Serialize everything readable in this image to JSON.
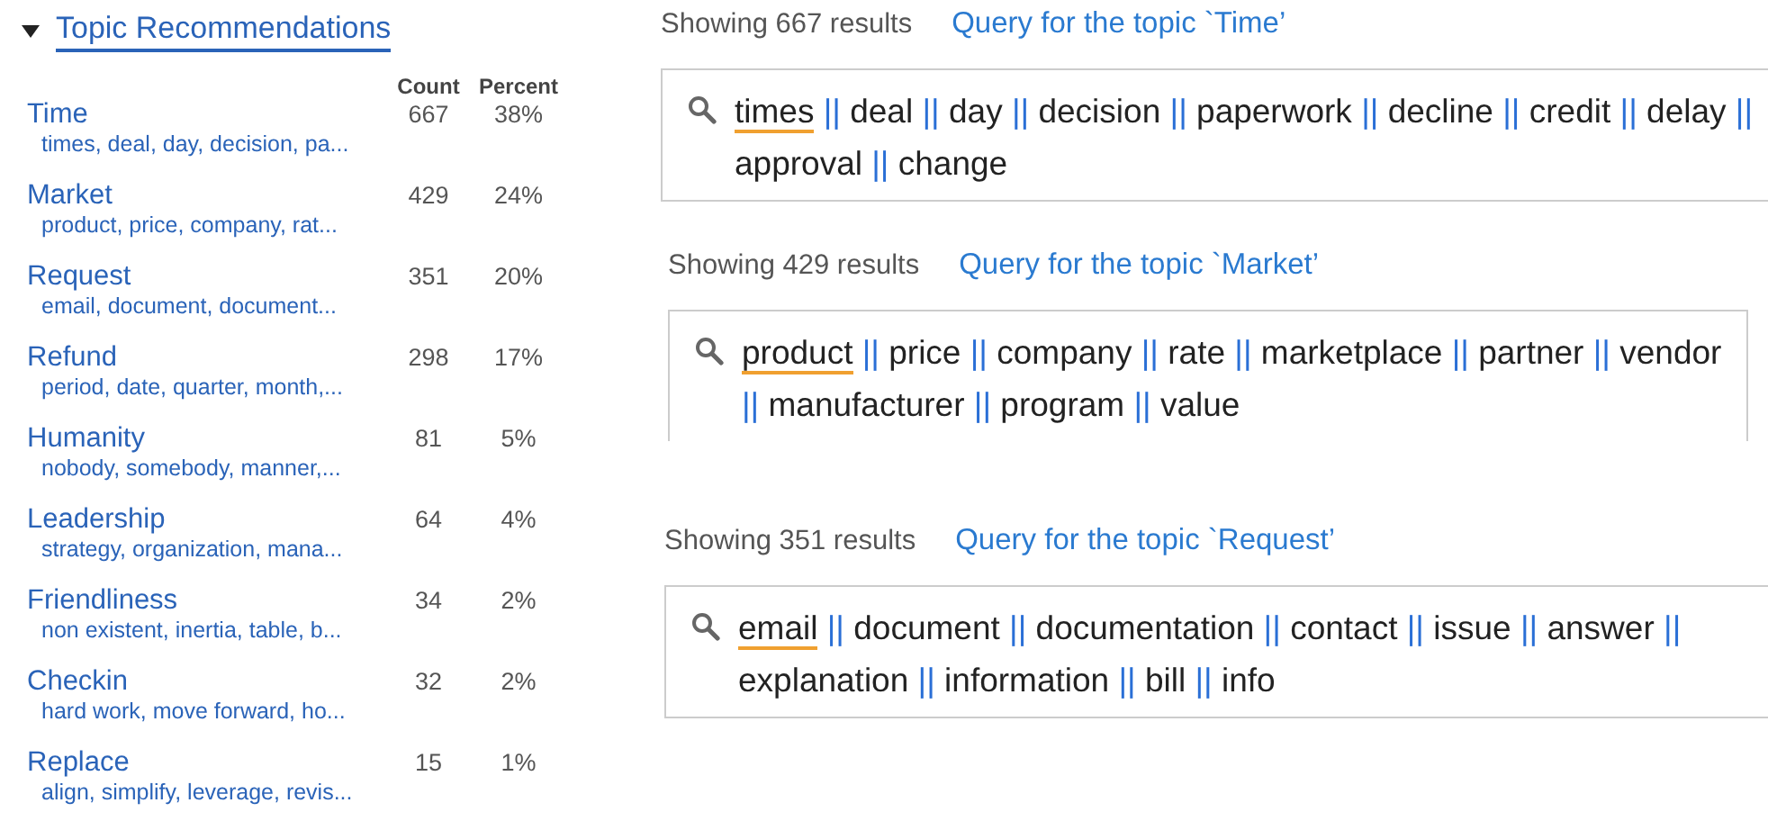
{
  "panel": {
    "title": "Topic Recommendations",
    "expanded": true,
    "columns": [
      "Count",
      "Percent"
    ],
    "topics": [
      {
        "name": "Time",
        "keywords": "times, deal, day, decision, pa...",
        "count": "667",
        "percent": "38%"
      },
      {
        "name": "Market",
        "keywords": "product, price, company, rat...",
        "count": "429",
        "percent": "24%"
      },
      {
        "name": "Request",
        "keywords": "email, document, document...",
        "count": "351",
        "percent": "20%"
      },
      {
        "name": "Refund",
        "keywords": "period, date, quarter, month,...",
        "count": "298",
        "percent": "17%"
      },
      {
        "name": "Humanity",
        "keywords": "nobody, somebody, manner,...",
        "count": "81",
        "percent": "5%"
      },
      {
        "name": "Leadership",
        "keywords": "strategy, organization, mana...",
        "count": "64",
        "percent": "4%"
      },
      {
        "name": "Friendliness",
        "keywords": "non existent, inertia, table, b...",
        "count": "34",
        "percent": "2%"
      },
      {
        "name": "Checkin",
        "keywords": "hard work, move forward, ho...",
        "count": "32",
        "percent": "2%"
      },
      {
        "name": "Replace",
        "keywords": "align, simplify, leverage, revis...",
        "count": "15",
        "percent": "1%"
      }
    ]
  },
  "queries": [
    {
      "results": "Showing 667 results",
      "title": "Query for the topic `Time’",
      "items": [
        {
          "kind": "term",
          "text": "times",
          "underlined": true
        },
        {
          "kind": "separator",
          "text": "||"
        },
        {
          "kind": "term",
          "text": "deal",
          "underlined": false
        },
        {
          "kind": "separator",
          "text": "||"
        },
        {
          "kind": "term",
          "text": "day",
          "underlined": false
        },
        {
          "kind": "separator",
          "text": "||"
        },
        {
          "kind": "term",
          "text": "decision",
          "underlined": false
        },
        {
          "kind": "separator",
          "text": "||"
        },
        {
          "kind": "term",
          "text": "paperwork",
          "underlined": false
        },
        {
          "kind": "separator",
          "text": "||"
        },
        {
          "kind": "term",
          "text": "decline",
          "underlined": false
        },
        {
          "kind": "separator",
          "text": "||"
        },
        {
          "kind": "term",
          "text": "credit",
          "underlined": false
        },
        {
          "kind": "separator",
          "text": "||"
        },
        {
          "kind": "term",
          "text": "delay",
          "underlined": false
        },
        {
          "kind": "separator",
          "text": "||"
        },
        {
          "kind": "term",
          "text": "approval",
          "underlined": false
        },
        {
          "kind": "separator",
          "text": "||"
        },
        {
          "kind": "term",
          "text": "change",
          "underlined": false
        }
      ]
    },
    {
      "results": "Showing 429 results",
      "title": "Query for the topic `Market’",
      "items": [
        {
          "kind": "term",
          "text": "product",
          "underlined": true
        },
        {
          "kind": "separator",
          "text": "||"
        },
        {
          "kind": "term",
          "text": "price",
          "underlined": false
        },
        {
          "kind": "separator",
          "text": "||"
        },
        {
          "kind": "term",
          "text": "company",
          "underlined": false
        },
        {
          "kind": "separator",
          "text": "||"
        },
        {
          "kind": "term",
          "text": "rate",
          "underlined": false
        },
        {
          "kind": "separator",
          "text": "||"
        },
        {
          "kind": "term",
          "text": "marketplace",
          "underlined": false
        },
        {
          "kind": "separator",
          "text": "||"
        },
        {
          "kind": "term",
          "text": "partner",
          "underlined": false
        },
        {
          "kind": "separator",
          "text": "||"
        },
        {
          "kind": "term",
          "text": "vendor",
          "underlined": false
        },
        {
          "kind": "separator",
          "text": "||"
        },
        {
          "kind": "term",
          "text": "manufacturer",
          "underlined": false
        },
        {
          "kind": "separator",
          "text": "||"
        },
        {
          "kind": "term",
          "text": "program",
          "underlined": false
        },
        {
          "kind": "separator",
          "text": "||"
        },
        {
          "kind": "term",
          "text": "value",
          "underlined": false
        }
      ]
    },
    {
      "results": "Showing 351 results",
      "title": "Query for the topic `Request’",
      "items": [
        {
          "kind": "term",
          "text": "email",
          "underlined": true
        },
        {
          "kind": "separator",
          "text": "||"
        },
        {
          "kind": "term",
          "text": "document",
          "underlined": false
        },
        {
          "kind": "separator",
          "text": "||"
        },
        {
          "kind": "term",
          "text": "documentation",
          "underlined": false
        },
        {
          "kind": "separator",
          "text": "||"
        },
        {
          "kind": "term",
          "text": "contact",
          "underlined": false
        },
        {
          "kind": "separator",
          "text": "||"
        },
        {
          "kind": "term",
          "text": "issue",
          "underlined": false
        },
        {
          "kind": "separator",
          "text": "||"
        },
        {
          "kind": "term",
          "text": "answer",
          "underlined": false
        },
        {
          "kind": "separator",
          "text": "||"
        },
        {
          "kind": "term",
          "text": "explanation",
          "underlined": false
        },
        {
          "kind": "separator",
          "text": "||"
        },
        {
          "kind": "term",
          "text": "information",
          "underlined": false
        },
        {
          "kind": "separator",
          "text": "||"
        },
        {
          "kind": "term",
          "text": "bill",
          "underlined": false
        },
        {
          "kind": "separator",
          "text": "||"
        },
        {
          "kind": "term",
          "text": "info",
          "underlined": false
        }
      ]
    }
  ]
}
